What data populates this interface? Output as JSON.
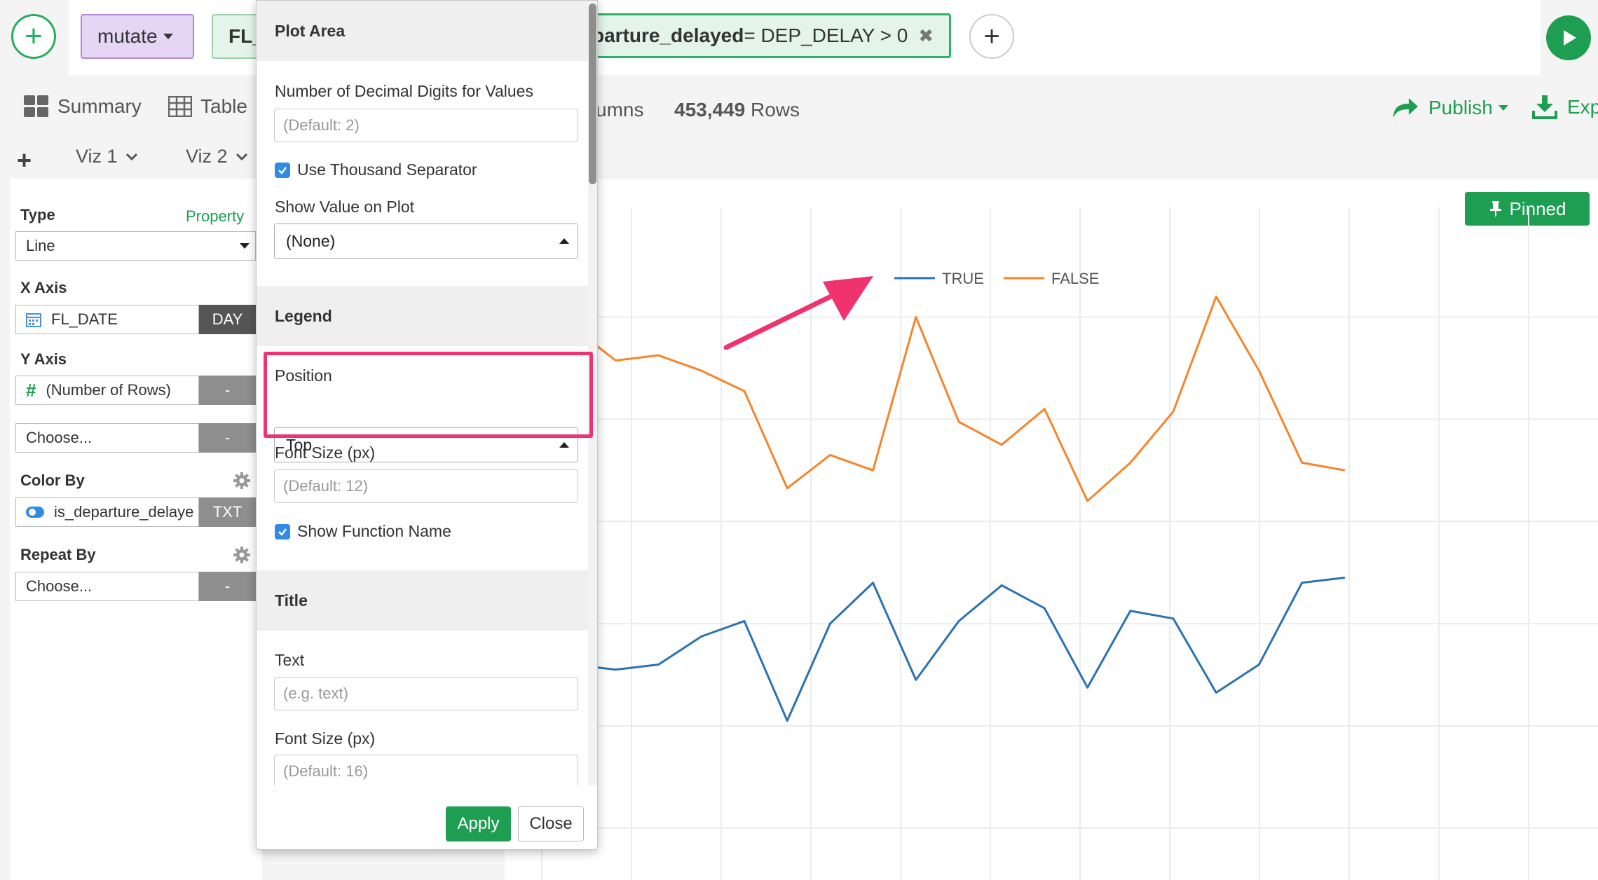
{
  "toolbar": {
    "mutate_label": "mutate",
    "fl_chip_label": "FL_",
    "formula_var": "parture_delayed",
    "formula_expr": " = DEP_DELAY > 0",
    "formula_close": "✖"
  },
  "tabs": {
    "summary": "Summary",
    "table": "Table",
    "columns_fragment": "umns",
    "rows_count": "453,449",
    "rows_label": " Rows",
    "publish": "Publish",
    "export_fragment": "Exp"
  },
  "viz_tabs": [
    "Viz 1",
    "Viz 2"
  ],
  "left_panel": {
    "type_label": "Type",
    "property_link": "Property",
    "type_value": "Line",
    "x_axis_label": "X Axis",
    "x_axis_value": "FL_DATE",
    "x_axis_tag": "DAY",
    "y_axis_label": "Y Axis",
    "y_axis_value": "(Number of Rows)",
    "y_axis_tag": "-",
    "y_axis2_value": "Choose...",
    "y_axis2_tag": "-",
    "color_by_label": "Color By",
    "color_by_value": "is_departure_delaye",
    "color_by_tag": "TXT",
    "repeat_by_label": "Repeat By",
    "repeat_by_value": "Choose...",
    "repeat_by_tag": "-"
  },
  "popup": {
    "plot_area_title": "Plot Area",
    "decimal_label": "Number of Decimal Digits for Values",
    "decimal_placeholder": "(Default: 2)",
    "thousand_sep_label": "Use Thousand Separator",
    "show_value_label": "Show Value on Plot",
    "show_value_selected": "(None)",
    "legend_title": "Legend",
    "position_label": "Position",
    "position_selected": "Top",
    "legend_font_label": "Font Size (px)",
    "legend_font_placeholder": "(Default: 12)",
    "show_function_label": "Show Function Name",
    "title_section": "Title",
    "text_label": "Text",
    "text_placeholder": "(e.g. text)",
    "title_font_label": "Font Size (px)",
    "title_font_placeholder": "(Default: 16)",
    "apply_label": "Apply",
    "close_label": "Close"
  },
  "pinned_label": "Pinned",
  "colors": {
    "accent_green": "#1d9e50",
    "highlight_pink": "#f0336f",
    "true_line": "#2b72b0",
    "false_line": "#f6852a"
  },
  "chart_data": {
    "type": "line",
    "legend": [
      "TRUE",
      "FALSE"
    ],
    "legend_position": "top",
    "grid": true,
    "series": [
      {
        "name": "TRUE",
        "values": [
          72,
          69,
          63,
          67,
          43,
          63,
          64,
          62,
          64,
          75,
          81,
          42,
          80,
          96,
          58,
          81,
          95,
          86,
          55,
          85,
          82,
          53,
          64,
          96,
          98
        ]
      },
      {
        "name": "FALSE",
        "values": [
          173,
          172,
          184,
          182,
          136,
          181,
          196,
          183,
          185,
          179,
          171,
          133,
          146,
          140,
          200,
          159,
          150,
          164,
          128,
          143,
          163,
          208,
          179,
          143,
          140
        ]
      }
    ]
  }
}
